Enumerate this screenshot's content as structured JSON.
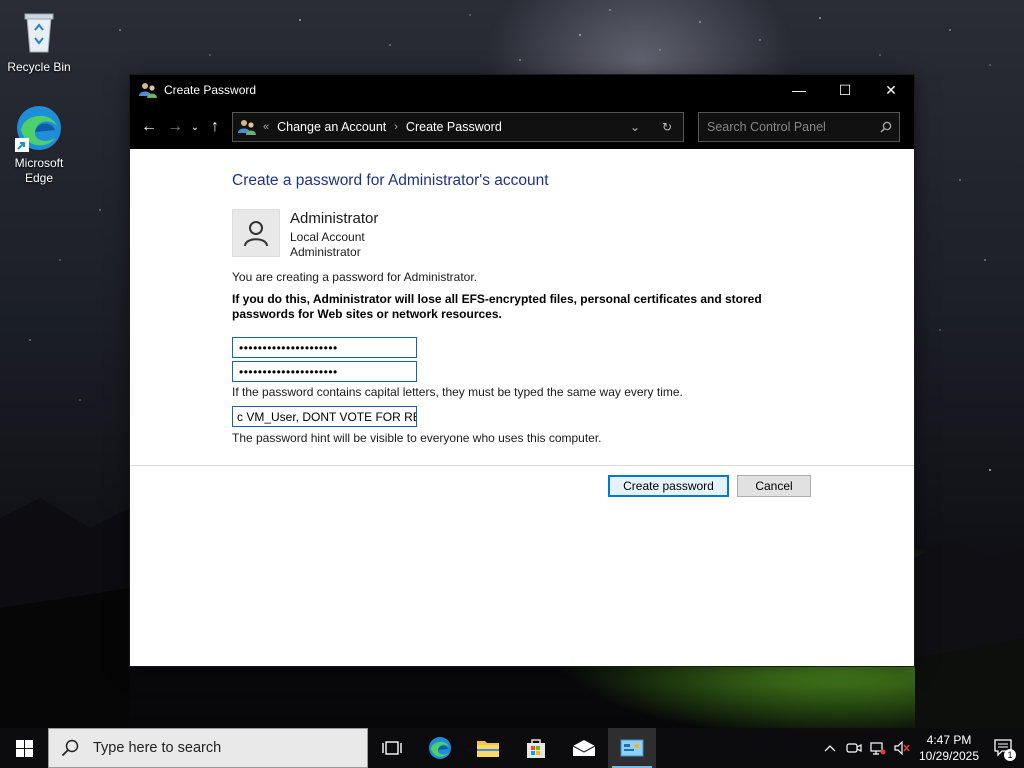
{
  "desktop": {
    "icons": [
      {
        "label": "Recycle Bin"
      },
      {
        "label": "Microsoft Edge"
      }
    ]
  },
  "window": {
    "title": "Create Password",
    "controls": {
      "minimize": "—",
      "maximize": "☐",
      "close": "✕"
    },
    "nav": {
      "back": "←",
      "forward": "→",
      "recent": "⌄",
      "up": "↑",
      "breadcrumb_sep_lead": "«",
      "breadcrumb": [
        "Change an Account",
        "Create Password"
      ],
      "breadcrumb_sep": "›",
      "dropdown": "⌄",
      "refresh": "↻"
    },
    "search": {
      "placeholder": "Search Control Panel"
    }
  },
  "content": {
    "heading": "Create a password for Administrator's account",
    "user": {
      "name": "Administrator",
      "type": "Local Account",
      "role": "Administrator"
    },
    "intro": "You are creating a password for Administrator.",
    "warning": "If you do this, Administrator will lose all EFS-encrypted files, personal certificates and stored passwords for Web sites or network resources.",
    "new_password_value": "•••••••••••••••••••••",
    "confirm_password_value": "•••••••••••••••••••••",
    "caps_note": "If the password contains capital letters, they must be typed the same way every time.",
    "hint_value": "c VM_User, DONT VOTE FOR RESE",
    "hint_note": "The password hint will be visible to everyone who uses this computer.",
    "buttons": {
      "create": "Create password",
      "cancel": "Cancel"
    }
  },
  "taskbar": {
    "search_placeholder": "Type here to search",
    "tray": {
      "chevron": "^",
      "time": "4:47 PM",
      "date": "10/29/2025",
      "notification_count": "1"
    }
  }
}
